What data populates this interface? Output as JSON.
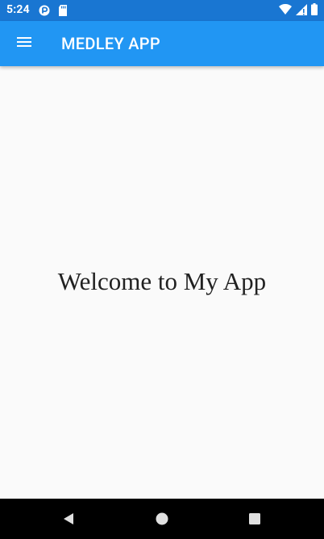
{
  "status_bar": {
    "time": "5:24",
    "icons_left": [
      "notification-circle-icon",
      "sd-card-icon"
    ],
    "icons_right": [
      "wifi-icon",
      "cell-signal-icon",
      "battery-icon"
    ]
  },
  "app_bar": {
    "title": "MEDLEY APP",
    "menu_icon": "hamburger-menu-icon",
    "color": "#2196f3"
  },
  "content": {
    "welcome_text": "Welcome to My App"
  },
  "nav_bar": {
    "buttons": [
      "back-icon",
      "home-icon",
      "recents-icon"
    ]
  },
  "colors": {
    "status_bar": "#1976d2",
    "app_bar": "#2196f3",
    "background": "#fafafa",
    "nav_bar": "#000000"
  }
}
